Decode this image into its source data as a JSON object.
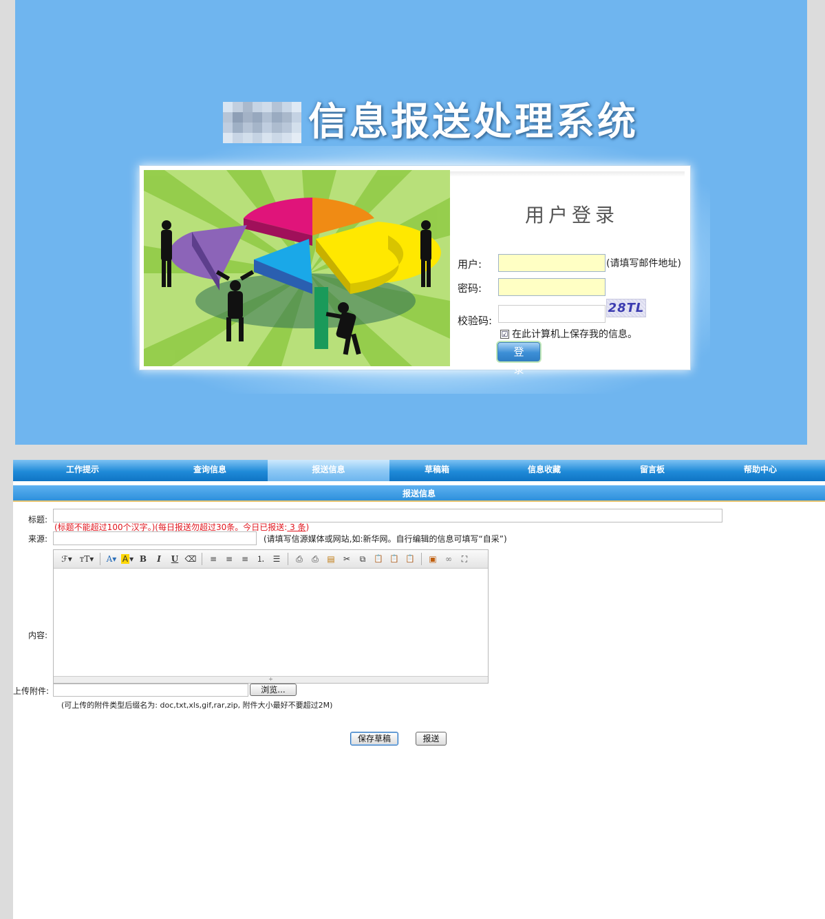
{
  "login": {
    "system_title": "信息报送处理系统",
    "heading": "用户登录",
    "user_label": "用户:",
    "user_hint": "(请填写邮件地址)",
    "password_label": "密码:",
    "captcha_label": "校验码:",
    "captcha_text": "28TL",
    "remember_check": "☑",
    "remember_label": "在此计算机上保存我的信息。",
    "login_button": "登 录"
  },
  "nav": {
    "items": [
      {
        "label": "工作提示"
      },
      {
        "label": "查询信息"
      },
      {
        "label": "报送信息"
      },
      {
        "label": "草稿箱"
      },
      {
        "label": "信息收藏"
      },
      {
        "label": "留言板"
      },
      {
        "label": "帮助中心"
      }
    ],
    "active_index": 2
  },
  "form": {
    "section_title": "报送信息",
    "title_label": "标题:",
    "title_note_prefix": "(标题不能超过100个汉字。)(每日报送勿超过30条。今日已报送:",
    "title_note_count": " 3 条",
    "title_note_suffix": ")",
    "source_label": "来源:",
    "source_note": "(请填写信源媒体或网站,如:新华网。自行编辑的信息可填写“自采”)",
    "content_label": "内容:",
    "attachment_label": "上传附件:",
    "browse_button": "浏览...",
    "upload_note": "(可上传的附件类型后缀名为: doc,txt,xls,gif,rar,zip, 附件大小最好不要超过2M)",
    "save_draft_button": "保存草稿",
    "submit_button": "报送"
  },
  "toolbar": {
    "font": "ℱ▾",
    "size": "тT▾",
    "font_color": "A▾",
    "highlight": "A",
    "highlight_arrow": "▾",
    "bold": "B",
    "italic": "I",
    "underline": "U",
    "eraser": "⌫",
    "align_left": "≡",
    "align_center": "≡",
    "align_right": "≡",
    "ordered_list": "⒈",
    "unordered_list": "☰",
    "preview": "⎙",
    "print": "⎙",
    "template": "▤",
    "cut": "✂",
    "copy": "⧉",
    "paste": "📋",
    "paste_text": "📋",
    "paste_word": "📋",
    "image": "▣",
    "link": "∞",
    "fullscreen": "⛶",
    "resize": "÷"
  },
  "colors": {
    "login_bg": "#6fb5ef",
    "nav_blue": "#1f8ad8",
    "warning_red": "#e0141c",
    "input_yellow": "#ffffc4"
  }
}
